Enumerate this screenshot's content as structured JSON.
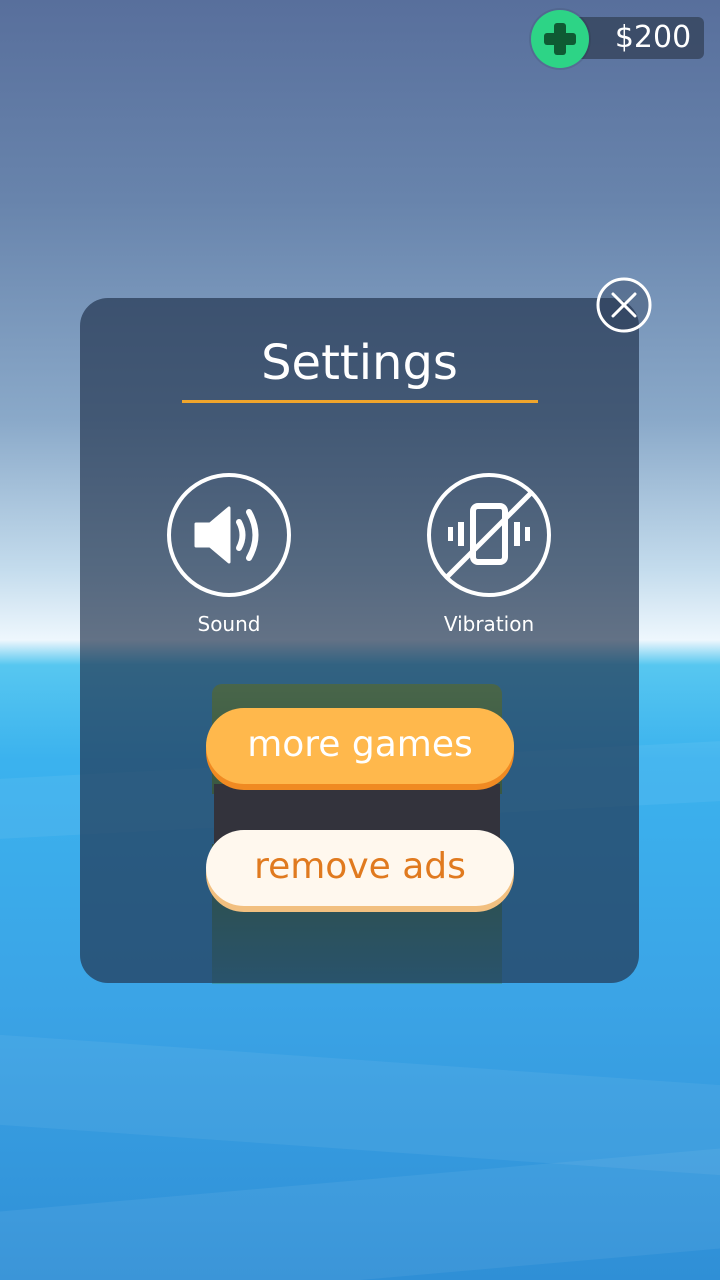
{
  "hud": {
    "currency_amount": "$200",
    "add_currency_icon": "plus-icon"
  },
  "settings": {
    "title": "Settings",
    "close_icon": "close-icon",
    "sound": {
      "label": "Sound",
      "icon": "speaker-icon",
      "enabled": true
    },
    "vibration": {
      "label": "Vibration",
      "icon": "vibration-off-icon",
      "enabled": false
    },
    "more_games_label": "more games",
    "remove_ads_label": "remove ads"
  },
  "colors": {
    "accent": "#f0a52c",
    "primary_button": "#ffb84c",
    "secondary_button_text": "#e07a1f",
    "currency_button": "#2dd486"
  }
}
